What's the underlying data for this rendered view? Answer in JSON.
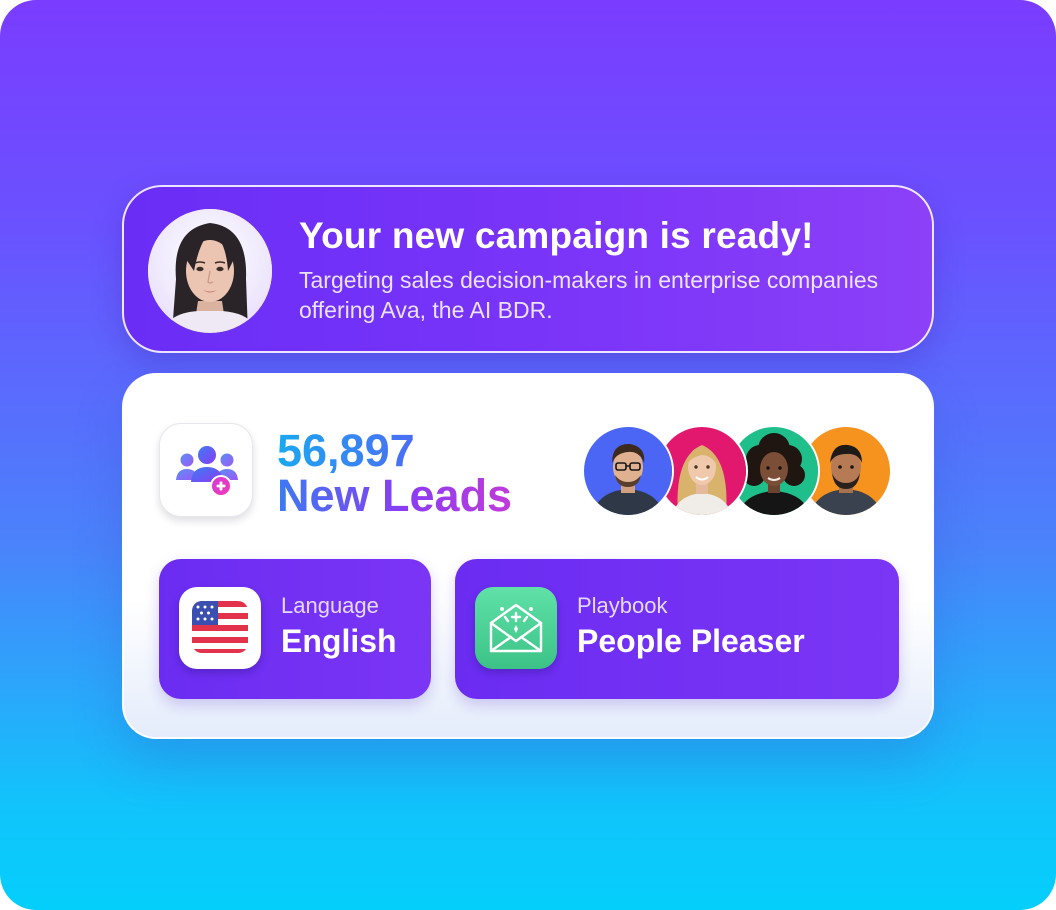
{
  "notification": {
    "title": "Your new campaign is ready!",
    "subtitle": "Targeting sales decision-makers in enterprise companies offering Ava, the AI BDR.",
    "avatar_icon": "woman-portrait-avatar"
  },
  "leads": {
    "count": "56,897",
    "label": "New Leads",
    "icon": "add-users-icon",
    "avatars": [
      "man-glasses-avatar",
      "woman-blonde-avatar",
      "woman-curly-avatar",
      "man-beard-avatar"
    ]
  },
  "settings": {
    "language": {
      "label": "Language",
      "value": "English",
      "icon": "us-flag-icon"
    },
    "playbook": {
      "label": "Playbook",
      "value": "People Pleaser",
      "icon": "envelope-sparkle-icon"
    }
  },
  "colors": {
    "background_top": "#7a3cff",
    "background_bottom": "#04cffb",
    "banner": "#7432f7",
    "tile": "#722ff4",
    "leads_gradient_start": "#1aa8f0",
    "leads_gradient_end": "#c13bd9",
    "playbook_icon": "#4fd49a"
  }
}
